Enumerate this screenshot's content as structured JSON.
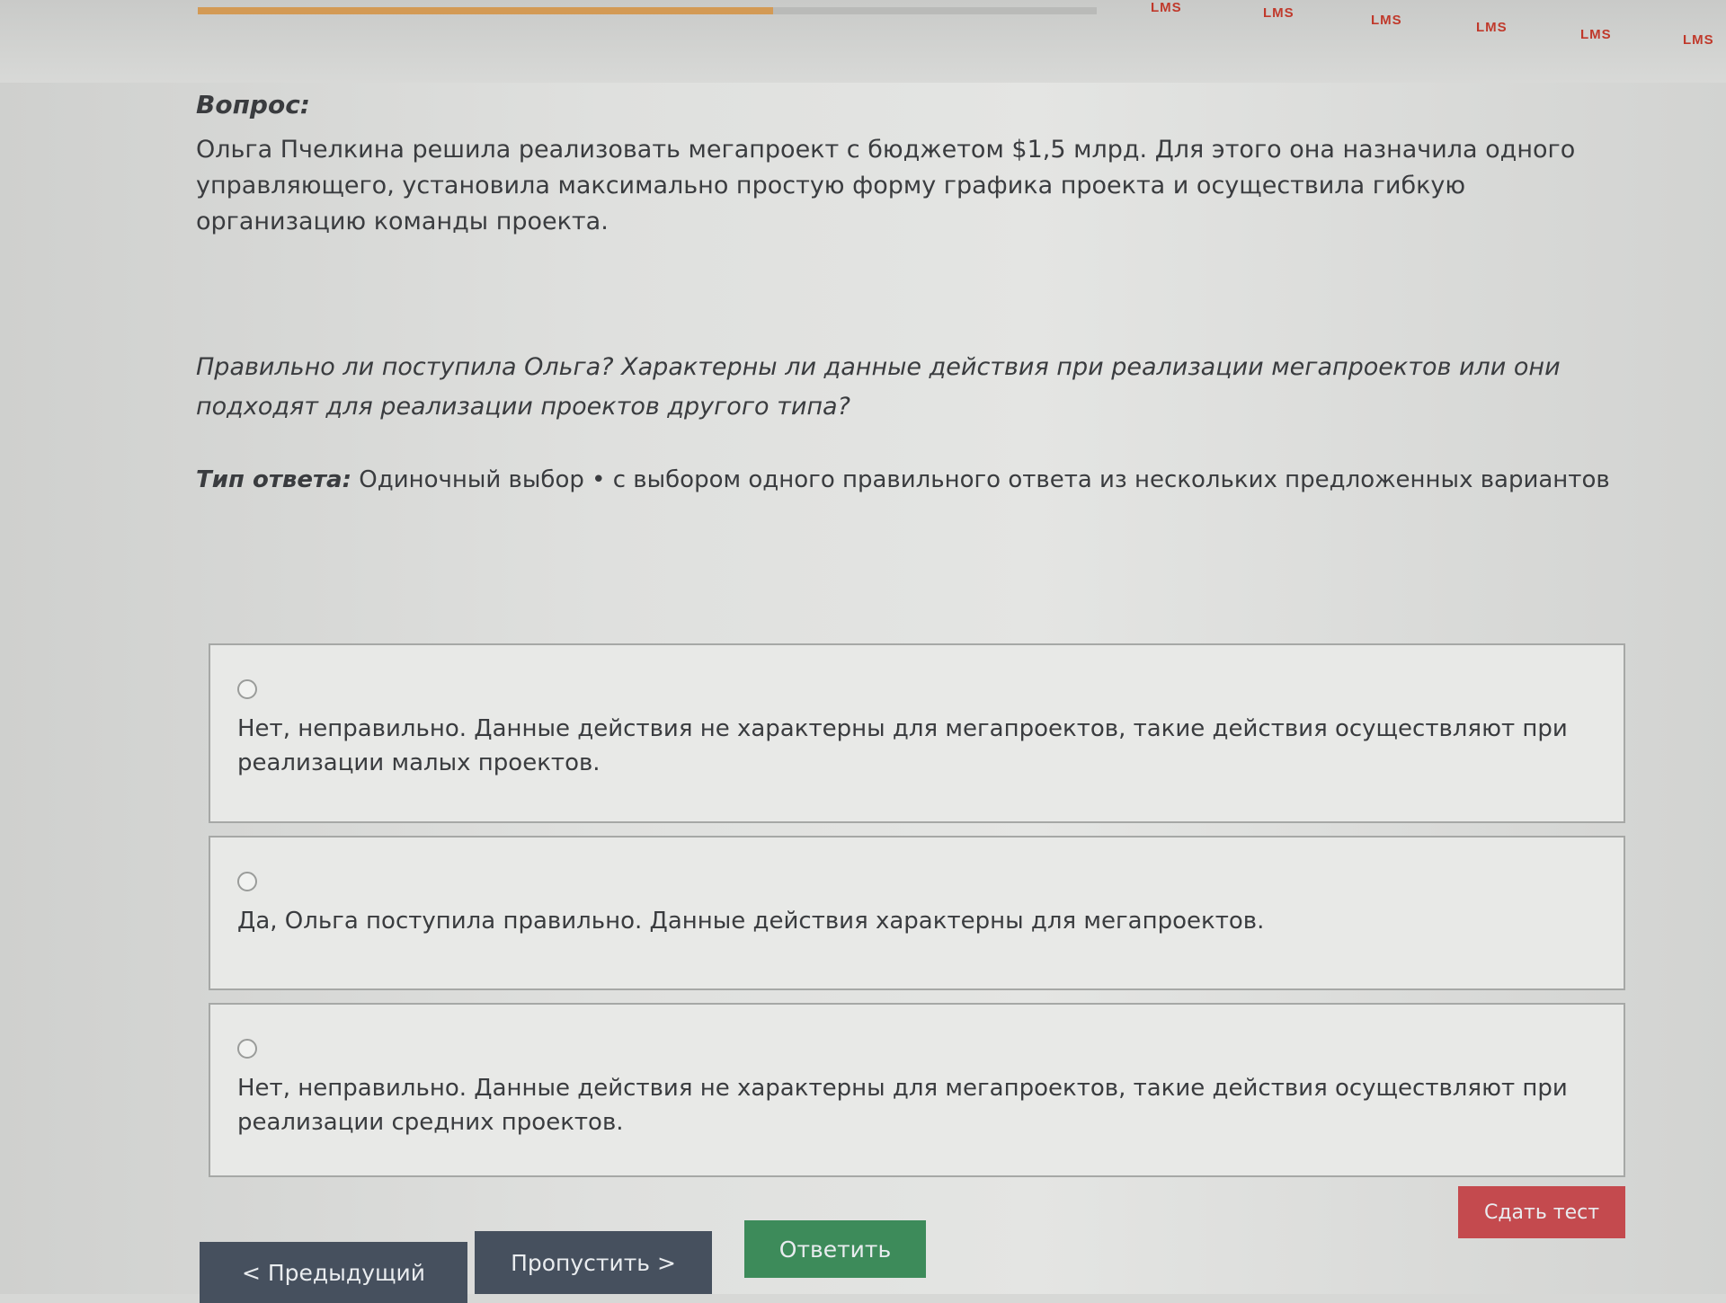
{
  "progress": {
    "value": 0.64
  },
  "header": {
    "tabs": [
      "LMS",
      "LMS",
      "LMS",
      "LMS",
      "LMS",
      "LMS"
    ]
  },
  "question": {
    "label": "Вопрос:",
    "text": "Ольга Пчелкина решила реализовать мегапроект с бюджетом $1,5 млрд. Для этого она назначила одного управляющего, установила максимально простую форму графика проекта и осуществила гибкую организацию команды проекта.",
    "prompt": "Правильно ли поступила Ольга? Характерны ли данные действия при реализации мегапроектов или они подходят для реализации проектов другого типа?",
    "answer_type_label": "Тип ответа:",
    "answer_type_value": " Одиночный выбор • с выбором одного правильного ответа из нескольких предложенных вариантов"
  },
  "options": [
    {
      "text": "Нет, неправильно. Данные действия не характерны для мегапроектов, такие действия осуществляют при реализации малых проектов.",
      "selected": false
    },
    {
      "text": "Да, Ольга поступила правильно. Данные действия характерны для мегапроектов.",
      "selected": false
    },
    {
      "text": "Нет, неправильно. Данные действия не характерны для мегапроектов, такие действия осуществляют при реализации средних проектов.",
      "selected": false
    }
  ],
  "buttons": {
    "prev": "< Предыдущий",
    "skip": "Пропустить >",
    "answer": "Ответить",
    "submit": "Сдать тест"
  },
  "colors": {
    "accent_progress": "#d39a55",
    "nav_button": "#46505e",
    "answer_button": "#3d8b5a",
    "submit_button": "#c44a4e",
    "lms_tab_text": "#c0392b"
  }
}
